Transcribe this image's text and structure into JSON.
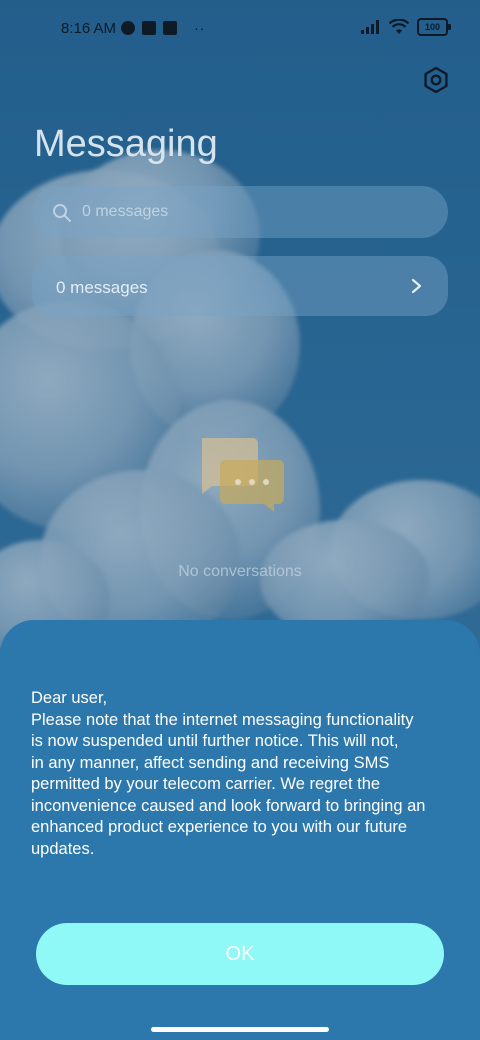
{
  "status_bar": {
    "time": "8:16 AM",
    "battery": "100"
  },
  "header": {
    "title": "Messaging",
    "settings_icon": "gear-icon"
  },
  "search": {
    "placeholder": "0 messages",
    "icon": "search-icon"
  },
  "messages_row": {
    "label": "0 messages",
    "icon": "chevron-right-icon"
  },
  "empty_state": {
    "icon": "chat-bubbles-icon",
    "text": "No conversations"
  },
  "dialog": {
    "lines": [
      "Dear user,",
      "Please note that the internet messaging functionality",
      "is now suspended until further notice. This will not,",
      "in any manner, affect sending and receiving SMS",
      "permitted by your telecom carrier. We regret the",
      "inconvenience caused and look forward to bringing an",
      "enhanced product experience to you with our future",
      "updates."
    ],
    "ok_label": "OK",
    "colors": {
      "sheet": "#2c78ac",
      "button": "#8ef9f6",
      "button_text": "#ffffff"
    }
  }
}
